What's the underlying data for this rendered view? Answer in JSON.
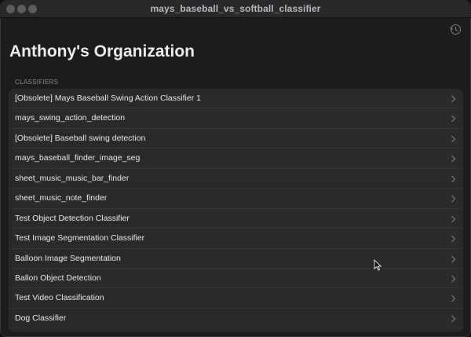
{
  "window": {
    "title": "mays_baseball_vs_softball_classifier"
  },
  "header": {
    "organization": "Anthony's Organization"
  },
  "section": {
    "label": "CLASSIFIERS"
  },
  "classifiers": [
    {
      "label": "[Obsolete] Mays Baseball Swing Action Classifier 1"
    },
    {
      "label": "mays_swing_action_detection"
    },
    {
      "label": "[Obsolete] Baseball swing detection"
    },
    {
      "label": "mays_baseball_finder_image_seg"
    },
    {
      "label": "sheet_music_music_bar_finder"
    },
    {
      "label": "sheet_music_note_finder"
    },
    {
      "label": "Test Object Detection Classifier"
    },
    {
      "label": "Test Image Segmentation Classifier"
    },
    {
      "label": "Balloon Image Segmentation"
    },
    {
      "label": "Ballon Object Detection"
    },
    {
      "label": "Test Video Classification"
    },
    {
      "label": "Dog Classifier"
    }
  ],
  "icons": {
    "row_chevron": "chevron-right-icon",
    "toolbar_sync": "sync-icon"
  },
  "colors": {
    "window_bg": "#1c1c1e",
    "list_bg": "#2a2a2d",
    "text": "#e8e8ea",
    "muted": "#8a8a8e"
  }
}
